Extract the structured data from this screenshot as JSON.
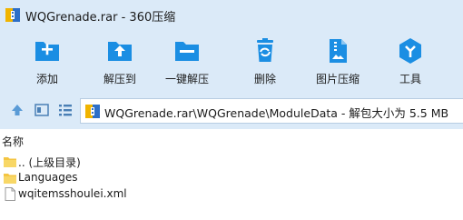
{
  "window": {
    "title": "WQGrenade.rar - 360压缩"
  },
  "toolbar": {
    "items": [
      {
        "label": "添加",
        "icon": "add-icon"
      },
      {
        "label": "解压到",
        "icon": "extract-to-icon"
      },
      {
        "label": "一键解压",
        "icon": "one-click-extract-icon"
      },
      {
        "label": "删除",
        "icon": "delete-icon"
      },
      {
        "label": "图片压缩",
        "icon": "image-compress-icon"
      },
      {
        "label": "工具",
        "icon": "tools-icon"
      }
    ]
  },
  "addressbar": {
    "path": "WQGrenade.rar\\WQGrenade\\ModuleData - 解包大小为 5.5 MB"
  },
  "filelist": {
    "column_name": "名称",
    "items": [
      {
        "name": ".. (上级目录)",
        "icon": "folder-icon"
      },
      {
        "name": "Languages",
        "icon": "folder-icon"
      },
      {
        "name": "wqitemsshoulei.xml",
        "icon": "file-icon"
      }
    ]
  },
  "colors": {
    "accent": "#1b8ee3",
    "toolbar_bg": "#dbeaf8"
  }
}
